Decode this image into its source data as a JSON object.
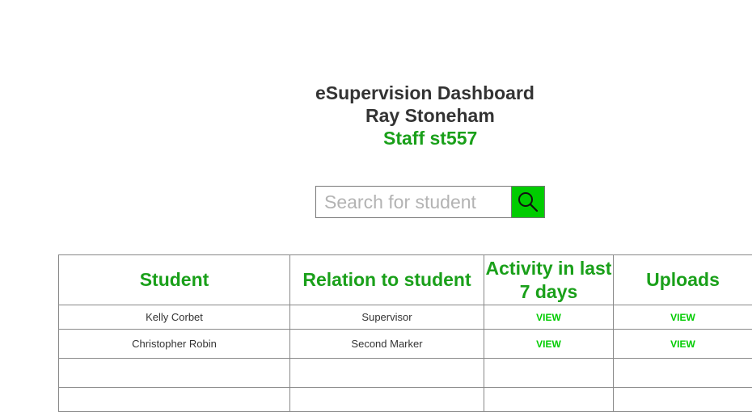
{
  "header": {
    "title": "eSupervision Dashboard",
    "user_name": "Ray Stoneham",
    "role_line": "Staff st557"
  },
  "search": {
    "placeholder": "Search for student",
    "value": "",
    "button_icon": "search-icon"
  },
  "table": {
    "columns": [
      "Student",
      "Relation to student",
      "Activity in last 7 days",
      "Uploads"
    ],
    "rows": [
      {
        "student": "Kelly Corbet",
        "relation": "Supervisor",
        "activity": "VIEW",
        "uploads": "VIEW"
      },
      {
        "student": "Christopher Robin",
        "relation": "Second Marker",
        "activity": "VIEW",
        "uploads": "VIEW"
      },
      {
        "student": "",
        "relation": "",
        "activity": "",
        "uploads": ""
      },
      {
        "student": "",
        "relation": "",
        "activity": "",
        "uploads": ""
      }
    ]
  },
  "colors": {
    "accent_green": "#00cc00",
    "heading_green": "#1aa01a",
    "text_dark": "#333333",
    "border": "#888888"
  }
}
